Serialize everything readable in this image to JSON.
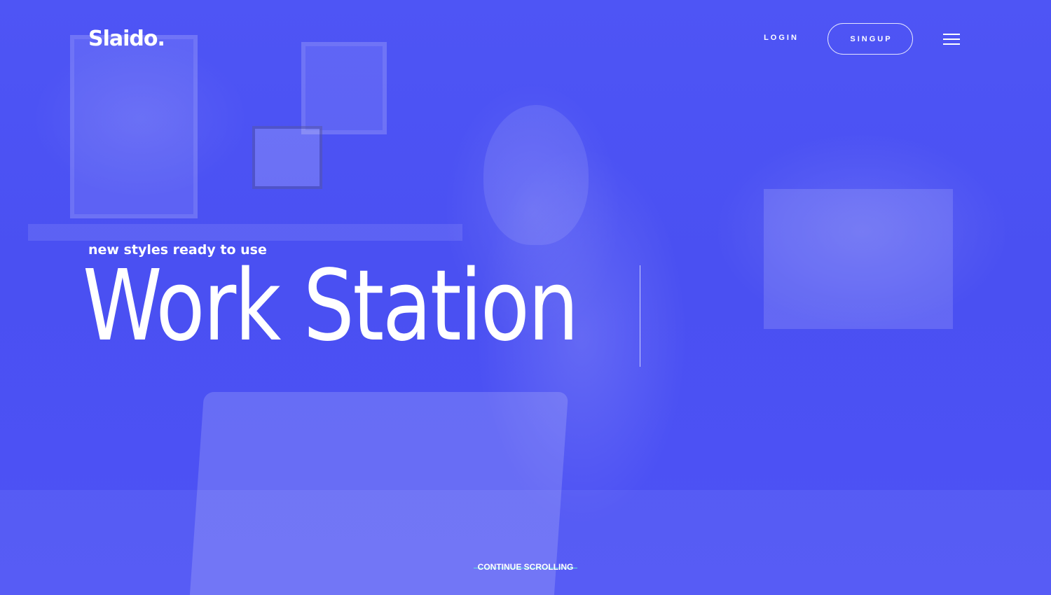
{
  "header": {
    "logo": "Slaido.",
    "nav": {
      "login_label": "LOGIN",
      "signup_label": "SINGUP"
    },
    "menu_icon": "hamburger-menu-icon"
  },
  "hero": {
    "subtitle": "new styles ready to use",
    "title": "Work Station",
    "scroll_label": "CONTINUE SCROLLING"
  },
  "colors": {
    "overlay": "#4a4ff7",
    "text": "#ffffff",
    "scroll_accent": "#5de4d6"
  }
}
